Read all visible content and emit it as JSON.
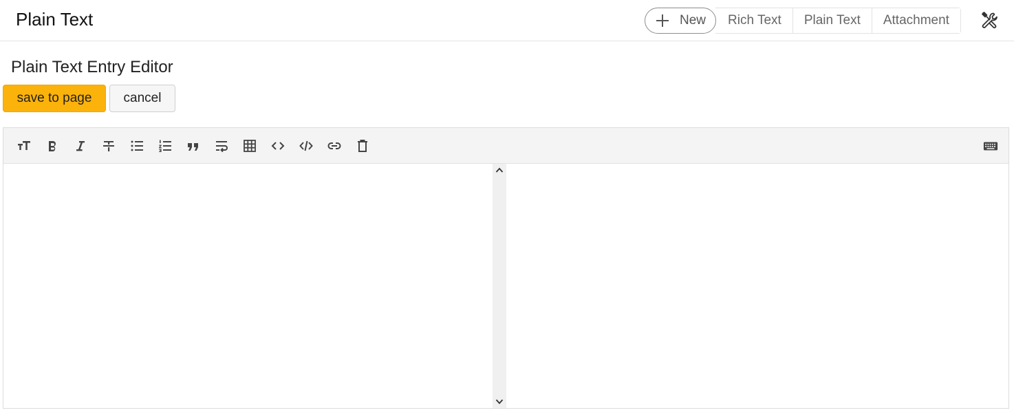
{
  "header": {
    "title": "Plain Text",
    "nav": {
      "new_label": "New",
      "tabs": [
        "Rich Text",
        "Plain Text",
        "Attachment"
      ]
    },
    "tools_icon": "tools-icon"
  },
  "editor": {
    "heading": "Plain Text Entry Editor",
    "save_label": "save to page",
    "cancel_label": "cancel",
    "toolbar_icons": [
      "heading-icon",
      "bold-icon",
      "italic-icon",
      "strikethrough-icon",
      "bullet-list-icon",
      "numbered-list-icon",
      "quote-icon",
      "wrap-icon",
      "table-icon",
      "code-icon",
      "code-block-icon",
      "link-icon",
      "delete-icon"
    ],
    "keyboard_icon": "keyboard-icon",
    "content": ""
  },
  "colors": {
    "accent": "#fbb20a",
    "toolbar_bg": "#f4f4f4",
    "icon": "#555555"
  }
}
